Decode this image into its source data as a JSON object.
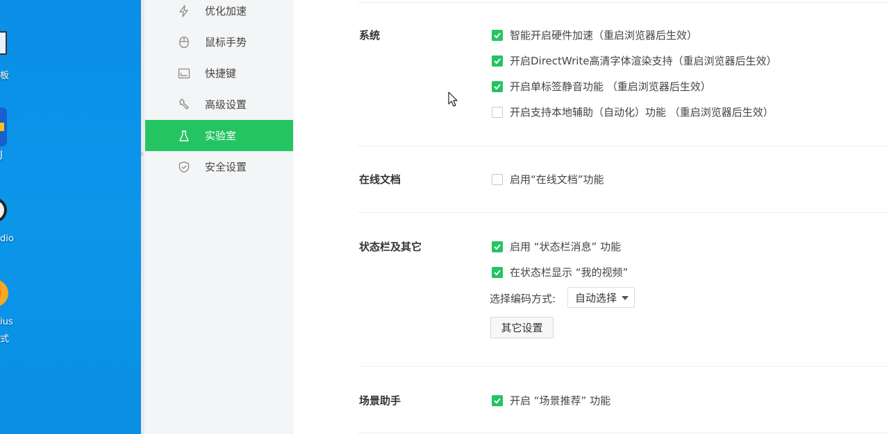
{
  "desktop": {
    "icons": [
      {
        "label": "板",
        "icon": "window-icon"
      },
      {
        "label": "J",
        "icon": "app-icon"
      },
      {
        "label": "dio",
        "icon": "disc-icon"
      },
      {
        "label": "ius",
        "label2": "式",
        "icon": "app-icon"
      }
    ]
  },
  "sidebar": {
    "items": [
      {
        "label": "优化加速",
        "icon": "lightning-icon"
      },
      {
        "label": "鼠标手势",
        "icon": "mouse-icon"
      },
      {
        "label": "快捷键",
        "icon": "keyboard-icon"
      },
      {
        "label": "高级设置",
        "icon": "wrench-icon"
      },
      {
        "label": "实验室",
        "icon": "flask-icon",
        "active": true
      },
      {
        "label": "安全设置",
        "icon": "shield-icon"
      }
    ]
  },
  "sections": {
    "system": {
      "title": "系统",
      "options": [
        {
          "label": "智能开启硬件加速（重启浏览器后生效）",
          "checked": true
        },
        {
          "label": "开启DirectWrite高清字体渲染支持（重启浏览器后生效）",
          "checked": true
        },
        {
          "label": "开启单标签静音功能 （重启浏览器后生效）",
          "checked": true
        },
        {
          "label": "开启支持本地辅助（自动化）功能 （重启浏览器后生效）",
          "checked": false
        }
      ]
    },
    "online_docs": {
      "title": "在线文档",
      "options": [
        {
          "label": "启用“在线文档”功能",
          "checked": false
        }
      ]
    },
    "statusbar": {
      "title": "状态栏及其它",
      "options": [
        {
          "label": "启用 “状态栏消息” 功能",
          "checked": true
        },
        {
          "label": "在状态栏显示 “我的视频”",
          "checked": true
        }
      ],
      "encoding_label": "选择编码方式:",
      "encoding_value": "自动选择",
      "other_button": "其它设置"
    },
    "scene": {
      "title": "场景助手",
      "options": [
        {
          "label": "开启 “场景推荐” 功能",
          "checked": true
        }
      ]
    }
  },
  "colors": {
    "accent": "#24c462",
    "desktop": "#0a8fe6"
  }
}
